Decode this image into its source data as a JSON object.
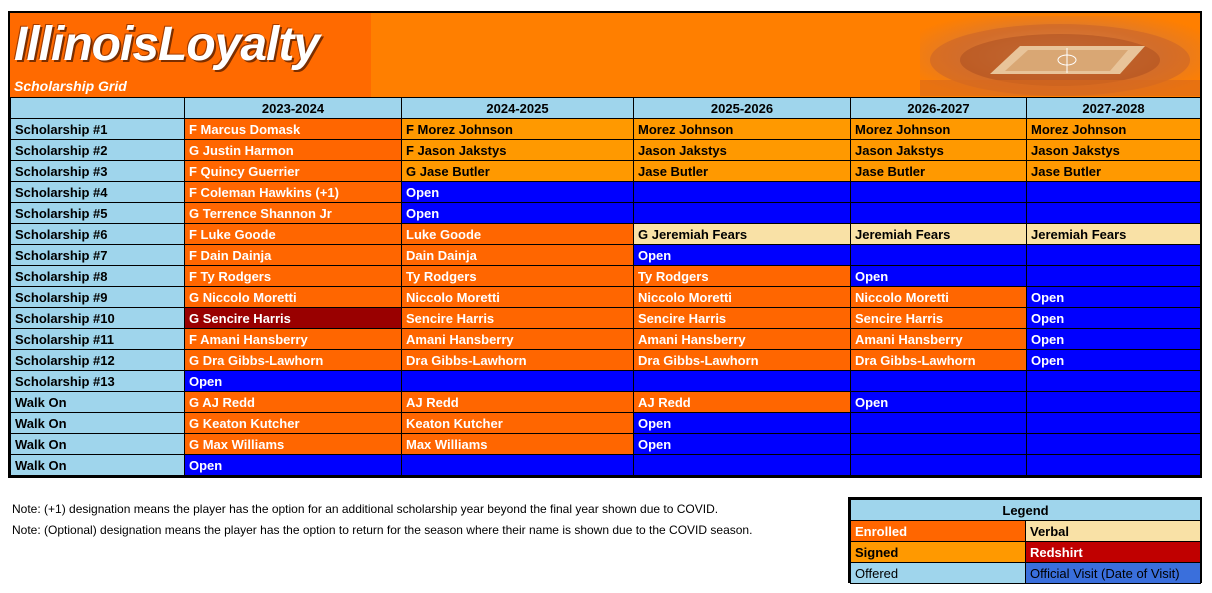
{
  "banner": {
    "logo": "IllinoisLoyalty",
    "subtitle": "Scholarship Grid"
  },
  "grid": {
    "years": [
      "2023-2024",
      "2024-2025",
      "2025-2026",
      "2026-2027",
      "2027-2028"
    ],
    "rows": [
      {
        "label": "Scholarship #1",
        "cells": [
          {
            "text": "F Marcus Domask",
            "status": "enrolled"
          },
          {
            "text": "F Morez Johnson",
            "status": "signed"
          },
          {
            "text": "Morez Johnson",
            "status": "signed"
          },
          {
            "text": "Morez Johnson",
            "status": "signed"
          },
          {
            "text": "Morez Johnson",
            "status": "signed"
          }
        ]
      },
      {
        "label": "Scholarship #2",
        "cells": [
          {
            "text": "G Justin Harmon",
            "status": "enrolled"
          },
          {
            "text": "F Jason Jakstys",
            "status": "signed"
          },
          {
            "text": "Jason Jakstys",
            "status": "signed"
          },
          {
            "text": "Jason Jakstys",
            "status": "signed"
          },
          {
            "text": "Jason Jakstys",
            "status": "signed"
          }
        ]
      },
      {
        "label": "Scholarship #3",
        "cells": [
          {
            "text": "F Quincy Guerrier",
            "status": "enrolled"
          },
          {
            "text": "G Jase Butler",
            "status": "signed"
          },
          {
            "text": "Jase Butler",
            "status": "signed"
          },
          {
            "text": "Jase Butler",
            "status": "signed"
          },
          {
            "text": "Jase Butler",
            "status": "signed"
          }
        ]
      },
      {
        "label": "Scholarship #4",
        "cells": [
          {
            "text": "F Coleman Hawkins (+1)",
            "status": "enrolled"
          },
          {
            "text": "Open",
            "status": "open"
          },
          {
            "text": "",
            "status": "open"
          },
          {
            "text": "",
            "status": "open"
          },
          {
            "text": "",
            "status": "open"
          }
        ]
      },
      {
        "label": "Scholarship #5",
        "cells": [
          {
            "text": "G Terrence Shannon Jr",
            "status": "enrolled"
          },
          {
            "text": "Open",
            "status": "open"
          },
          {
            "text": "",
            "status": "open"
          },
          {
            "text": "",
            "status": "open"
          },
          {
            "text": "",
            "status": "open"
          }
        ]
      },
      {
        "label": "Scholarship #6",
        "cells": [
          {
            "text": "F Luke Goode",
            "status": "enrolled"
          },
          {
            "text": "Luke Goode",
            "status": "enrolled"
          },
          {
            "text": "G Jeremiah Fears",
            "status": "verbal"
          },
          {
            "text": "Jeremiah Fears",
            "status": "verbal"
          },
          {
            "text": "Jeremiah Fears",
            "status": "verbal"
          }
        ]
      },
      {
        "label": "Scholarship #7",
        "cells": [
          {
            "text": "F Dain Dainja",
            "status": "enrolled"
          },
          {
            "text": "Dain Dainja",
            "status": "enrolled"
          },
          {
            "text": "Open",
            "status": "open"
          },
          {
            "text": "",
            "status": "open"
          },
          {
            "text": "",
            "status": "open"
          }
        ]
      },
      {
        "label": "Scholarship #8",
        "cells": [
          {
            "text": "F Ty Rodgers",
            "status": "enrolled"
          },
          {
            "text": "Ty Rodgers",
            "status": "enrolled"
          },
          {
            "text": "Ty Rodgers",
            "status": "enrolled"
          },
          {
            "text": "Open",
            "status": "open"
          },
          {
            "text": "",
            "status": "open"
          }
        ]
      },
      {
        "label": "Scholarship #9",
        "cells": [
          {
            "text": "G Niccolo Moretti",
            "status": "enrolled"
          },
          {
            "text": "Niccolo Moretti",
            "status": "enrolled"
          },
          {
            "text": "Niccolo Moretti",
            "status": "enrolled"
          },
          {
            "text": "Niccolo Moretti",
            "status": "enrolled"
          },
          {
            "text": "Open",
            "status": "open"
          }
        ]
      },
      {
        "label": "Scholarship #10",
        "cells": [
          {
            "text": "G Sencire Harris",
            "status": "redshirt"
          },
          {
            "text": "Sencire Harris",
            "status": "enrolled"
          },
          {
            "text": "Sencire Harris",
            "status": "enrolled"
          },
          {
            "text": "Sencire Harris",
            "status": "enrolled"
          },
          {
            "text": "Open",
            "status": "open"
          }
        ]
      },
      {
        "label": "Scholarship #11",
        "cells": [
          {
            "text": "F Amani Hansberry",
            "status": "enrolled"
          },
          {
            "text": "Amani Hansberry",
            "status": "enrolled"
          },
          {
            "text": "Amani Hansberry",
            "status": "enrolled"
          },
          {
            "text": "Amani Hansberry",
            "status": "enrolled"
          },
          {
            "text": "Open",
            "status": "open"
          }
        ]
      },
      {
        "label": "Scholarship #12",
        "cells": [
          {
            "text": "G Dra Gibbs-Lawhorn",
            "status": "enrolled"
          },
          {
            "text": "Dra Gibbs-Lawhorn",
            "status": "enrolled"
          },
          {
            "text": "Dra Gibbs-Lawhorn",
            "status": "enrolled"
          },
          {
            "text": "Dra Gibbs-Lawhorn",
            "status": "enrolled"
          },
          {
            "text": "Open",
            "status": "open"
          }
        ]
      },
      {
        "label": "Scholarship #13",
        "cells": [
          {
            "text": "Open",
            "status": "open"
          },
          {
            "text": "",
            "status": "open"
          },
          {
            "text": "",
            "status": "open"
          },
          {
            "text": "",
            "status": "open"
          },
          {
            "text": "",
            "status": "open"
          }
        ]
      },
      {
        "label": "Walk On",
        "cells": [
          {
            "text": "G AJ Redd",
            "status": "enrolled"
          },
          {
            "text": "AJ Redd",
            "status": "enrolled"
          },
          {
            "text": "AJ Redd",
            "status": "enrolled"
          },
          {
            "text": "Open",
            "status": "open"
          },
          {
            "text": "",
            "status": "open"
          }
        ]
      },
      {
        "label": "Walk On",
        "cells": [
          {
            "text": "G Keaton Kutcher",
            "status": "enrolled"
          },
          {
            "text": "Keaton Kutcher",
            "status": "enrolled"
          },
          {
            "text": "Open",
            "status": "open"
          },
          {
            "text": "",
            "status": "open"
          },
          {
            "text": "",
            "status": "open"
          }
        ]
      },
      {
        "label": "Walk On",
        "cells": [
          {
            "text": "G Max Williams",
            "status": "enrolled"
          },
          {
            "text": "Max Williams",
            "status": "enrolled"
          },
          {
            "text": "Open",
            "status": "open"
          },
          {
            "text": "",
            "status": "open"
          },
          {
            "text": "",
            "status": "open"
          }
        ]
      },
      {
        "label": "Walk On",
        "cells": [
          {
            "text": "Open",
            "status": "open"
          },
          {
            "text": "",
            "status": "open"
          },
          {
            "text": "",
            "status": "open"
          },
          {
            "text": "",
            "status": "open"
          },
          {
            "text": "",
            "status": "open"
          }
        ]
      }
    ]
  },
  "notes": [
    "Note: (+1) designation means the player has the option for an additional scholarship year beyond the final year shown due to COVID.",
    "Note: (Optional) designation means the player has the option to return for the season where their name is shown due to the COVID season."
  ],
  "legend": {
    "title": "Legend",
    "enrolled": "Enrolled",
    "verbal": "Verbal",
    "signed": "Signed",
    "redshirt": "Redshirt",
    "offered": "Offered",
    "official_visit": "Official Visit (Date of Visit)"
  },
  "colors": {
    "enrolled": "#ff6600",
    "signed": "#ff9900",
    "open": "#0000ff",
    "verbal": "#f9e1a6",
    "redshirt": "#990000",
    "header": "#9fd5ec"
  }
}
